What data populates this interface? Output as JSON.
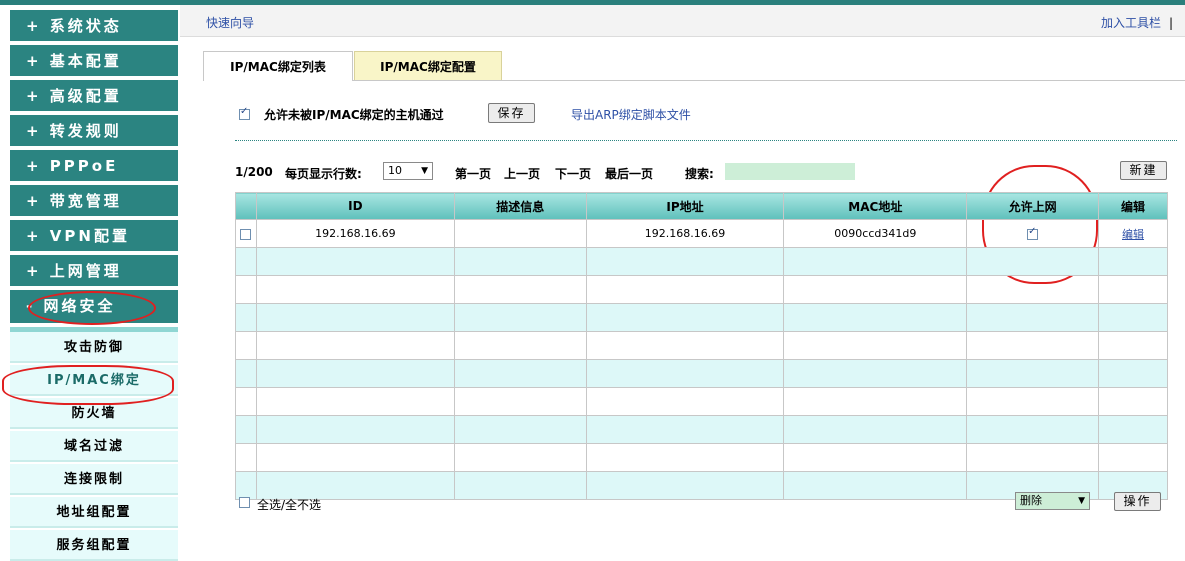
{
  "sidebar": {
    "main_items": [
      {
        "label": "+ 系统状态"
      },
      {
        "label": "+ 基本配置"
      },
      {
        "label": "+ 高级配置"
      },
      {
        "label": "+ 转发规则"
      },
      {
        "label": "+ PPPoE"
      },
      {
        "label": "+ 带宽管理"
      },
      {
        "label": "+ VPN配置"
      },
      {
        "label": "+ 上网管理"
      },
      {
        "label": "- 网络安全"
      }
    ],
    "sub_items": [
      {
        "label": "攻击防御"
      },
      {
        "label": "IP/MAC绑定"
      },
      {
        "label": "防火墙"
      },
      {
        "label": "域名过滤"
      },
      {
        "label": "连接限制"
      },
      {
        "label": "地址组配置"
      },
      {
        "label": "服务组配置"
      }
    ]
  },
  "header": {
    "quick_wizard": "快速向导",
    "add_toolbar": "加入工具栏",
    "separator": "|"
  },
  "tabs": [
    {
      "label": "IP/MAC绑定列表"
    },
    {
      "label": "IP/MAC绑定配置"
    }
  ],
  "allow_row": {
    "label": "允许未被IP/MAC绑定的主机通过",
    "checked": true,
    "save_button": "保存",
    "export_link": "导出ARP绑定脚本文件"
  },
  "pager": {
    "page_info": "1/200",
    "rows_label": "每页显示行数:",
    "rows_value": "10",
    "first": "第一页",
    "prev": "上一页",
    "next": "下一页",
    "last": "最后一页",
    "search_label": "搜索:",
    "new_button": "新建"
  },
  "table": {
    "headers": [
      "ID",
      "描述信息",
      "IP地址",
      "MAC地址",
      "允许上网",
      "编辑"
    ],
    "rows": [
      {
        "id": "192.168.16.69",
        "desc": "",
        "ip": "192.168.16.69",
        "mac": "0090ccd341d9",
        "allow": true,
        "edit": "编辑"
      }
    ]
  },
  "footer": {
    "select_all": "全选/全不选",
    "action_value": "删除",
    "action_button": "操作"
  },
  "colors": {
    "sidebar_bg": "#2b8481",
    "sub_bg": "#e6fbfb",
    "link": "#2e50a6",
    "header_th": "#6cc9c4",
    "alt_row": "#ddf8f8",
    "annotation": "#e02020"
  }
}
